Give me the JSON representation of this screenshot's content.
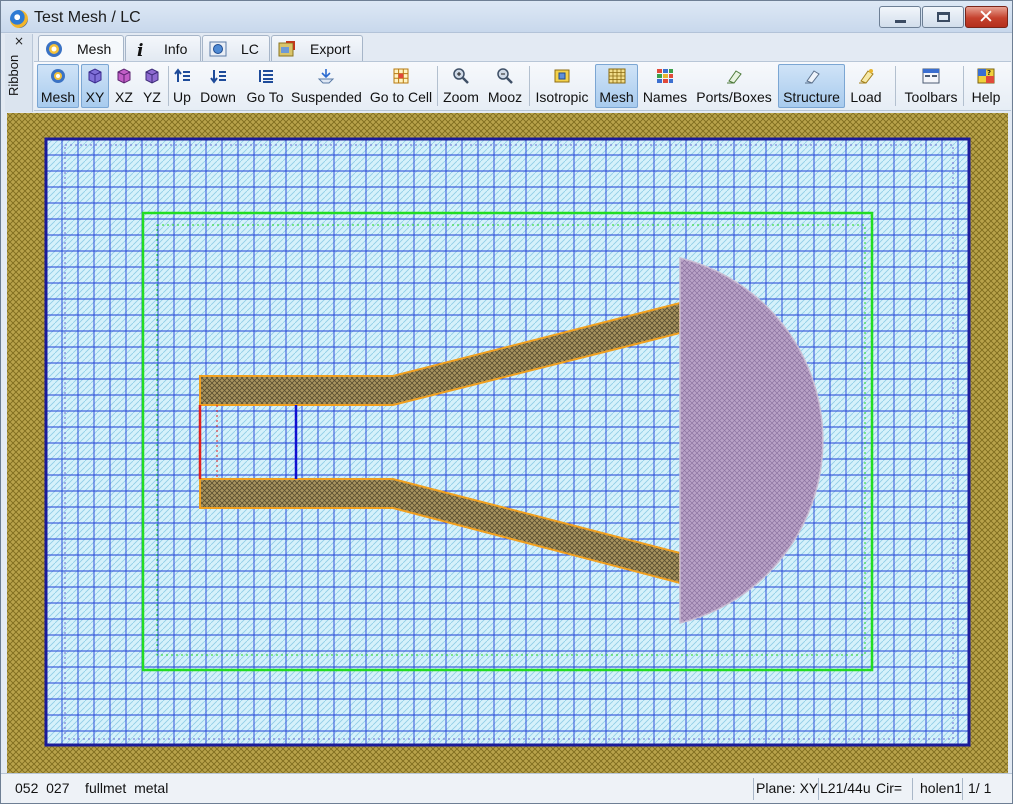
{
  "window": {
    "title": "Test Mesh / LC"
  },
  "ribbon_side": {
    "close": "×",
    "label": "Ribbon"
  },
  "tabs": [
    {
      "label": "Mesh",
      "icon": "mesh-tab-icon",
      "active": true
    },
    {
      "label": "Info",
      "icon": "info-icon",
      "active": false
    },
    {
      "label": "LC",
      "icon": "lc-icon",
      "active": false
    },
    {
      "label": "Export",
      "icon": "export-icon",
      "active": false
    }
  ],
  "toolbar": {
    "mesh": "Mesh",
    "xy": "XY",
    "xz": "XZ",
    "yz": "YZ",
    "up": "Up",
    "down": "Down",
    "goto": "Go To",
    "suspended": "Suspended",
    "goto_cell": "Go to Cell",
    "zoom": "Zoom",
    "mooz": "Mooz",
    "isotropic": "Isotropic",
    "mesh2": "Mesh",
    "names": "Names",
    "ports": "Ports/Boxes",
    "structure": "Structure",
    "load": "Load",
    "toolbars": "Toolbars",
    "help": "Help"
  },
  "status": {
    "left": "052  027    fullmet  metal",
    "plane": "Plane: XY",
    "layer": "L21/44u",
    "cir": "Cir=",
    "name": "holen1",
    "page": "1/ 1"
  },
  "colors": {
    "border_fill": "#b8a24a",
    "grid_bg": "#cdeefa",
    "grid_line": "#1f3fd6",
    "outer_rect": "#1b1b9a",
    "green_box": "#22dd22",
    "metal_fill": "#9d8a4e",
    "metal_edge": "#f0a020",
    "disc_fill": "#b39bc3",
    "port_red": "#e02020",
    "port_blue": "#1010d0"
  }
}
